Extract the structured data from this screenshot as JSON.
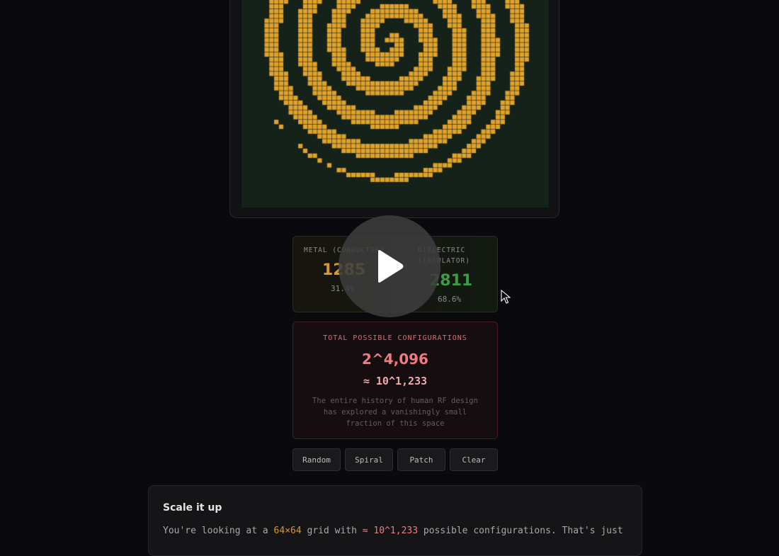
{
  "grid": {
    "size": 64,
    "pattern": "spiral",
    "metal_color": "#e0a22a",
    "dielectric_color": "#15221a"
  },
  "stats": {
    "metal_label": "METAL (CONDUCTOR)",
    "metal_value": "1285",
    "metal_pct": "31.4%",
    "metal_color": "#d69a30",
    "dielectric_label": "DIELECTRIC (INSULATOR)",
    "dielectric_value": "2811",
    "dielectric_pct": "68.6%",
    "dielectric_color": "#3e9a44"
  },
  "config": {
    "title": "TOTAL POSSIBLE CONFIGURATIONS",
    "power": "2^4,096",
    "approx": "≈ 10^1,233",
    "description": "The entire history of human RF design has explored a vanishingly small fraction of this space"
  },
  "buttons": {
    "random": "Random",
    "spiral": "Spiral",
    "patch": "Patch",
    "clear": "Clear"
  },
  "scale": {
    "title": "Scale it up",
    "text_pre": "You're looking at a ",
    "grid_dims": "64×64",
    "text_mid": " grid with ",
    "approx": "≈ 10^1,233",
    "text_post": " possible configurations. That's just"
  },
  "overlay": {
    "icon": "play-icon"
  }
}
